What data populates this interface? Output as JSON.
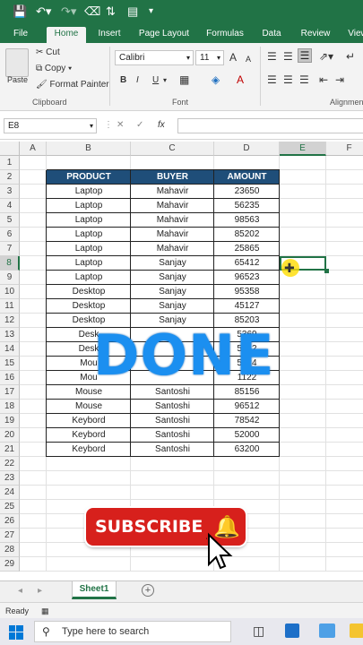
{
  "ribbon_tabs": [
    "File",
    "Home",
    "Insert",
    "Page Layout",
    "Formulas",
    "Data",
    "Review",
    "View"
  ],
  "clipboard": {
    "paste": "Paste",
    "cut": "Cut",
    "copy": "Copy",
    "format_painter": "Format Painter",
    "group": "Clipboard"
  },
  "font": {
    "name": "Calibri",
    "size": "11",
    "bold": "B",
    "italic": "I",
    "underline": "U",
    "group": "Font",
    "grow": "A",
    "shrink": "A"
  },
  "alignment": {
    "group": "Alignmen"
  },
  "formula_bar": {
    "name_box": "E8",
    "fx": "fx",
    "value": ""
  },
  "columns": [
    "A",
    "B",
    "C",
    "D",
    "E",
    "F"
  ],
  "rows": [
    "1",
    "2",
    "3",
    "4",
    "5",
    "6",
    "7",
    "8",
    "9",
    "10",
    "11",
    "12",
    "13",
    "14",
    "15",
    "16",
    "17",
    "18",
    "19",
    "20",
    "21",
    "22",
    "23",
    "24",
    "25",
    "26",
    "27",
    "28",
    "29"
  ],
  "table": {
    "headers": [
      "PRODUCT",
      "BUYER",
      "AMOUNT"
    ],
    "rows": [
      [
        "Laptop",
        "Mahavir",
        "23650"
      ],
      [
        "Laptop",
        "Mahavir",
        "56235"
      ],
      [
        "Laptop",
        "Mahavir",
        "98563"
      ],
      [
        "Laptop",
        "Mahavir",
        "85202"
      ],
      [
        "Laptop",
        "Mahavir",
        "25865"
      ],
      [
        "Laptop",
        "Sanjay",
        "65412"
      ],
      [
        "Laptop",
        "Sanjay",
        "96523"
      ],
      [
        "Desktop",
        "Sanjay",
        "95358"
      ],
      [
        "Desktop",
        "Sanjay",
        "45127"
      ],
      [
        "Desktop",
        "Sanjay",
        "85203"
      ],
      [
        "Desk",
        "",
        "5369"
      ],
      [
        "Desk",
        "",
        "5412"
      ],
      [
        "Mou",
        "",
        "5124"
      ],
      [
        "Mou",
        "",
        "1122"
      ],
      [
        "Mouse",
        "Santoshi",
        "85156"
      ],
      [
        "Mouse",
        "Santoshi",
        "96512"
      ],
      [
        "Keybord",
        "Santoshi",
        "78542"
      ],
      [
        "Keybord",
        "Santoshi",
        "52000"
      ],
      [
        "Keybord",
        "Santoshi",
        "63200"
      ]
    ]
  },
  "overlay": {
    "done": "DONE",
    "subscribe": "SUBSCRIBE"
  },
  "sheet_tab": "Sheet1",
  "status": "Ready",
  "taskbar": {
    "search_placeholder": "Type here to search"
  },
  "colors": {
    "excel_green": "#217346",
    "header_fill": "#1f4e79",
    "done_blue": "#1b8ff0",
    "subscribe_red": "#d7201c"
  }
}
